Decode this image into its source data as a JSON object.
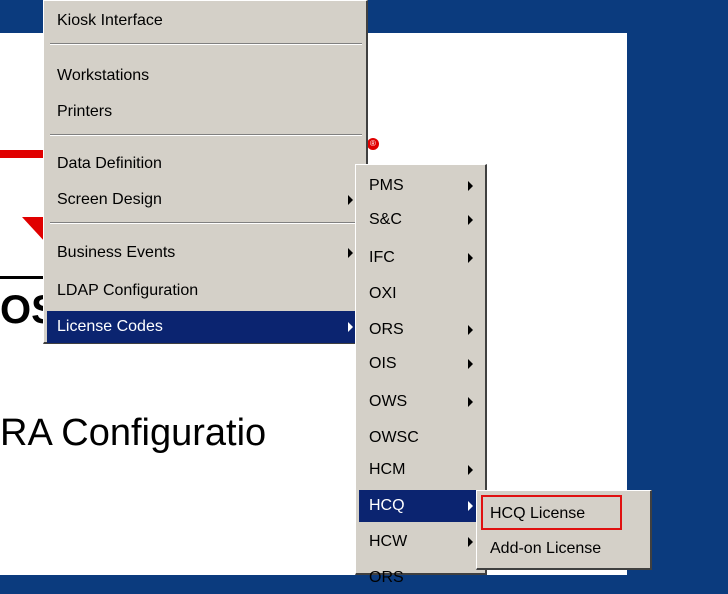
{
  "background": {
    "title_fragment": "RA Configuratio",
    "logo_fragment": "OS",
    "reg_mark": "®"
  },
  "menu_main": {
    "items": [
      {
        "label": "Kiosk Interface"
      },
      {
        "label": "Workstations"
      },
      {
        "label": "Printers"
      },
      {
        "label": "Data Definition"
      },
      {
        "label": "Screen Design",
        "submenu": true
      },
      {
        "label": "Business Events",
        "submenu": true
      },
      {
        "label": "LDAP Configuration"
      },
      {
        "label": "License Codes",
        "submenu": true,
        "selected": true
      }
    ]
  },
  "menu_license_codes": {
    "items": [
      {
        "label": "PMS",
        "submenu": true
      },
      {
        "label": "S&C",
        "submenu": true
      },
      {
        "label": "IFC",
        "submenu": true
      },
      {
        "label": "OXI"
      },
      {
        "label": "ORS",
        "submenu": true
      },
      {
        "label": "OIS",
        "submenu": true
      },
      {
        "label": "OWS",
        "submenu": true
      },
      {
        "label": "OWSC"
      },
      {
        "label": "HCM",
        "submenu": true
      },
      {
        "label": "HCQ",
        "submenu": true,
        "selected": true
      },
      {
        "label": "HCW",
        "submenu": true
      },
      {
        "label": "ORS"
      }
    ]
  },
  "menu_hcq": {
    "items": [
      {
        "label": "HCQ License",
        "highlighted": true
      },
      {
        "label": "Add-on License"
      }
    ]
  },
  "colors": {
    "desktop": "#0b3b7e",
    "menu_bg": "#d4d0c8",
    "selection": "#0b2470",
    "highlight_border": "#e01010",
    "brand_red": "#e00000"
  }
}
